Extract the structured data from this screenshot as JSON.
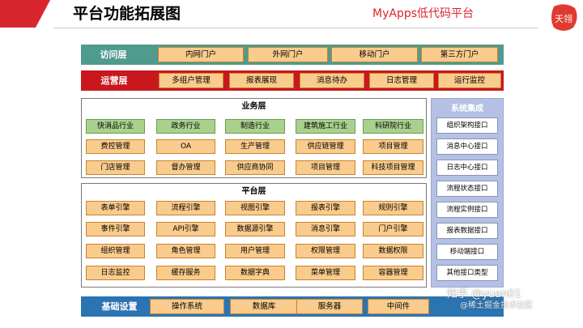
{
  "header": {
    "title": "平台功能拓展图",
    "brand": "MyApps低代码平台",
    "logo_text": "天翎"
  },
  "access_layer": {
    "label": "访问层",
    "items": [
      "内网门户",
      "外网门户",
      "移动门户",
      "第三方门户"
    ]
  },
  "ops_layer": {
    "label": "运营层",
    "items": [
      "多组户管理",
      "报表展现",
      "消息待办",
      "日志管理",
      "运行监控"
    ]
  },
  "business_layer": {
    "title": "业务层",
    "rows": [
      [
        "快消品行业",
        "政务行业",
        "制造行业",
        "建筑施工行业",
        "科研院行业"
      ],
      [
        "费控管理",
        "OA",
        "生产管理",
        "供应链管理",
        "项目管理"
      ],
      [
        "门店管理",
        "督办管理",
        "供应商协同",
        "项目管理",
        "科技项目管理"
      ]
    ]
  },
  "platform_layer": {
    "title": "平台层",
    "rows": [
      [
        "表单引擎",
        "流程引擎",
        "视图引擎",
        "报表引擎",
        "规则引擎"
      ],
      [
        "事件引擎",
        "API引擎",
        "数据源引擎",
        "消息引擎",
        "门户引擎"
      ],
      [
        "组织管理",
        "角色管理",
        "用户管理",
        "权限管理",
        "数据权限"
      ],
      [
        "日志监控",
        "缓存服务",
        "数据字典",
        "菜单管理",
        "容器管理"
      ]
    ]
  },
  "integration": {
    "title": "系统集成",
    "items": [
      "组织架构接口",
      "消息中心接口",
      "日志中心接口",
      "流程状态接口",
      "流程实例接口",
      "报表数据接口",
      "移动端接口",
      "其他接口类型"
    ]
  },
  "base_layer": {
    "label": "基础设置",
    "items": [
      "操作系统",
      "数据库",
      "服务器",
      "中间件"
    ]
  },
  "watermark": {
    "line1": "知乎 @yuan01",
    "line2": "@稀土掘金技术社区"
  },
  "colors": {
    "access": "#4f9b8e",
    "ops": "#c8181e",
    "base": "#2b74b2",
    "cell": "#f9cb8c",
    "industry": "#a9d18e",
    "integration": "#b4c1e4",
    "brand": "#d9262e"
  }
}
